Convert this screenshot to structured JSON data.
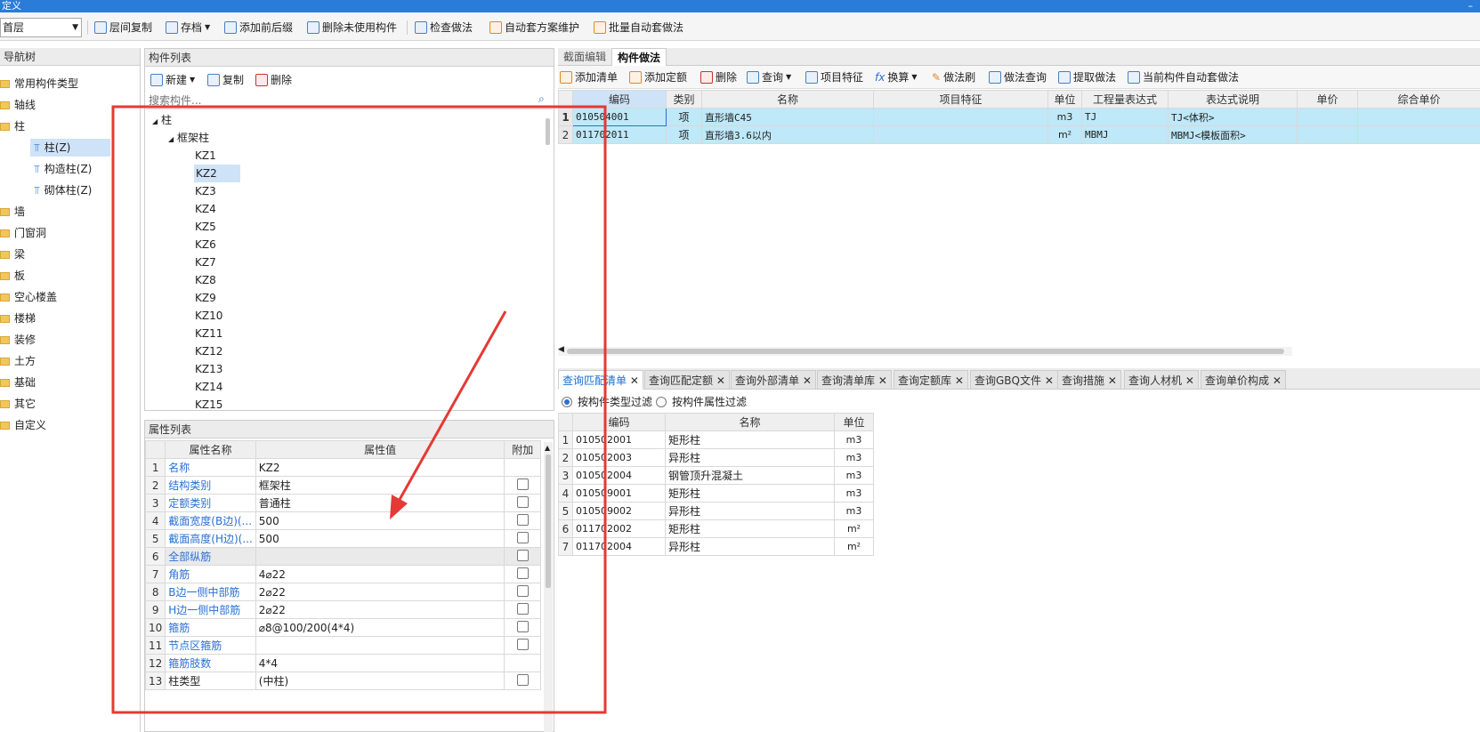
{
  "window": {
    "title": "定义",
    "minimize": "–"
  },
  "toolbar": {
    "floor": "首层",
    "items": [
      "层间复制",
      "存档",
      "添加前后缀",
      "删除未使用构件",
      "检查做法",
      "自动套方案维护",
      "批量自动套做法"
    ]
  },
  "nav": {
    "title": "导航树",
    "items": [
      "常用构件类型",
      "轴线",
      "柱",
      "柱(Z)",
      "构造柱(Z)",
      "砌体柱(Z)",
      "墙",
      "门窗洞",
      "梁",
      "板",
      "空心楼盖",
      "楼梯",
      "装修",
      "土方",
      "基础",
      "其它",
      "自定义"
    ]
  },
  "complist": {
    "title": "构件列表",
    "buttons": [
      "新建",
      "复制",
      "删除"
    ],
    "search_placeholder": "搜索构件...",
    "root": "柱",
    "group": "框架柱",
    "items": [
      "KZ1",
      "KZ2",
      "KZ3",
      "KZ4",
      "KZ5",
      "KZ6",
      "KZ7",
      "KZ8",
      "KZ9",
      "KZ10",
      "KZ11",
      "KZ12",
      "KZ13",
      "KZ14",
      "KZ15"
    ]
  },
  "props": {
    "title": "属性列表",
    "headers": [
      "属性名称",
      "属性值",
      "附加"
    ],
    "rows": [
      {
        "n": "1",
        "name": "名称",
        "value": "KZ2"
      },
      {
        "n": "2",
        "name": "结构类别",
        "value": "框架柱"
      },
      {
        "n": "3",
        "name": "定额类别",
        "value": "普通柱"
      },
      {
        "n": "4",
        "name": "截面宽度(B边)(...",
        "value": "500"
      },
      {
        "n": "5",
        "name": "截面高度(H边)(...",
        "value": "500"
      },
      {
        "n": "6",
        "name": "全部纵筋",
        "value": ""
      },
      {
        "n": "7",
        "name": "角筋",
        "value": "4⌀22"
      },
      {
        "n": "8",
        "name": "B边一侧中部筋",
        "value": "2⌀22"
      },
      {
        "n": "9",
        "name": "H边一侧中部筋",
        "value": "2⌀22"
      },
      {
        "n": "10",
        "name": "箍筋",
        "value": "⌀8@100/200(4*4)"
      },
      {
        "n": "11",
        "name": "节点区箍筋",
        "value": ""
      },
      {
        "n": "12",
        "name": "箍筋肢数",
        "value": "4*4"
      },
      {
        "n": "13",
        "name": "柱类型",
        "value": "(中柱)"
      }
    ]
  },
  "right": {
    "tabs": [
      "截面编辑",
      "构件做法"
    ],
    "buttons": [
      "添加清单",
      "添加定额",
      "删除",
      "查询",
      "项目特征",
      "换算",
      "做法刷",
      "做法查询",
      "提取做法",
      "当前构件自动套做法"
    ],
    "headers": [
      "编码",
      "类别",
      "名称",
      "项目特征",
      "单位",
      "工程量表达式",
      "表达式说明",
      "单价",
      "综合单价"
    ],
    "rows": [
      {
        "n": "1",
        "code": "010504001",
        "type": "项",
        "name": "直形墙C45",
        "feature": "",
        "unit": "m3",
        "expr": "TJ",
        "desc": "TJ<体积>"
      },
      {
        "n": "2",
        "code": "011702011",
        "type": "项",
        "name": "直形墙3.6以内",
        "feature": "",
        "unit": "m²",
        "expr": "MBMJ",
        "desc": "MBMJ<模板面积>"
      }
    ]
  },
  "query": {
    "tabs": [
      "查询匹配清单",
      "查询匹配定额",
      "查询外部清单",
      "查询清单库",
      "查询定额库",
      "查询GBQ文件",
      "查询措施",
      "查询人材机",
      "查询单价构成"
    ],
    "filter1": "按构件类型过滤",
    "filter2": "按构件属性过滤",
    "headers": [
      "编码",
      "名称",
      "单位"
    ],
    "rows": [
      {
        "n": "1",
        "code": "010502001",
        "name": "矩形柱",
        "unit": "m3"
      },
      {
        "n": "2",
        "code": "010502003",
        "name": "异形柱",
        "unit": "m3"
      },
      {
        "n": "3",
        "code": "010502004",
        "name": "钢管顶升混凝土",
        "unit": "m3"
      },
      {
        "n": "4",
        "code": "010509001",
        "name": "矩形柱",
        "unit": "m3"
      },
      {
        "n": "5",
        "code": "010509002",
        "name": "异形柱",
        "unit": "m3"
      },
      {
        "n": "6",
        "code": "011702002",
        "name": "矩形柱",
        "unit": "m²"
      },
      {
        "n": "7",
        "code": "011702004",
        "name": "异形柱",
        "unit": "m²"
      }
    ]
  },
  "colors": {
    "highlight": "#e53935",
    "accent": "#2b7bd9",
    "selected_row": "#bfe8f8"
  }
}
